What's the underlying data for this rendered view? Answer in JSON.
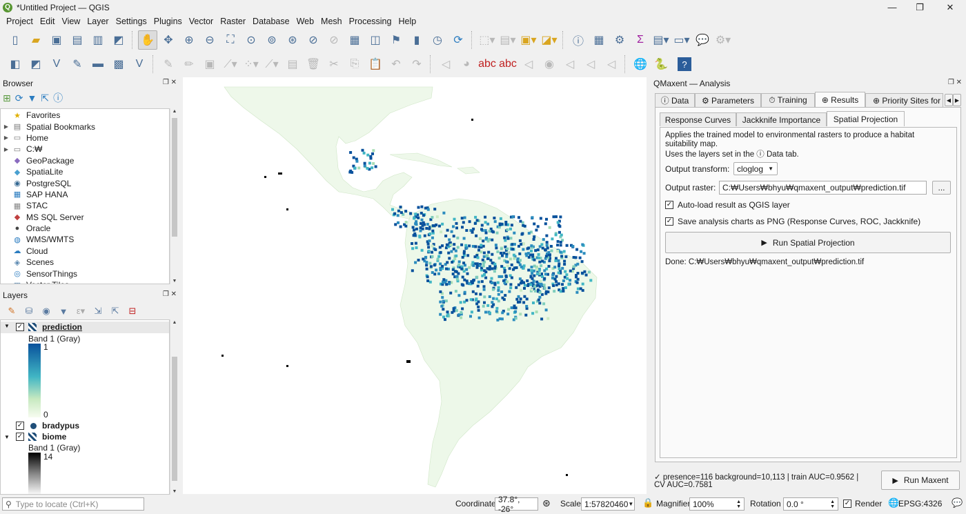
{
  "window": {
    "title": "*Untitled Project — QGIS",
    "minimize": "—",
    "maximize": "❐",
    "close": "✕"
  },
  "menu": [
    "Project",
    "Edit",
    "View",
    "Layer",
    "Settings",
    "Plugins",
    "Vector",
    "Raster",
    "Database",
    "Web",
    "Mesh",
    "Processing",
    "Help"
  ],
  "browser": {
    "title": "Browser",
    "items": [
      {
        "label": "Favorites",
        "icon": "star-icon"
      },
      {
        "label": "Spatial Bookmarks",
        "icon": "bookmark-icon"
      },
      {
        "label": "Home",
        "icon": "folder-icon"
      },
      {
        "label": "C:₩",
        "icon": "drive-icon"
      },
      {
        "label": "GeoPackage",
        "icon": "geopackage-icon"
      },
      {
        "label": "SpatiaLite",
        "icon": "spatialite-icon"
      },
      {
        "label": "PostgreSQL",
        "icon": "postgresql-icon"
      },
      {
        "label": "SAP HANA",
        "icon": "saphana-icon"
      },
      {
        "label": "STAC",
        "icon": "stac-icon"
      },
      {
        "label": "MS SQL Server",
        "icon": "mssql-icon"
      },
      {
        "label": "Oracle",
        "icon": "oracle-icon"
      },
      {
        "label": "WMS/WMTS",
        "icon": "wms-icon"
      },
      {
        "label": "Cloud",
        "icon": "cloud-icon"
      },
      {
        "label": "Scenes",
        "icon": "scenes-icon"
      },
      {
        "label": "SensorThings",
        "icon": "sensorthings-icon"
      },
      {
        "label": "Vector Tiles",
        "icon": "vectortiles-icon"
      }
    ]
  },
  "layers": {
    "title": "Layers",
    "prediction": {
      "name": "prediction",
      "band": "Band 1 (Gray)",
      "max": "1",
      "min": "0"
    },
    "bradypus": {
      "name": "bradypus"
    },
    "biome": {
      "name": "biome",
      "band": "Band 1 (Gray)",
      "max": "14"
    }
  },
  "dock": {
    "title": "QMaxent — Analysis",
    "tabs": [
      "ⓘ Data",
      "⚙ Parameters",
      "⏱ Training",
      "⊕ Results",
      "⊕ Priority Sites for S"
    ],
    "subtabs": [
      "Response Curves",
      "Jackknife Importance",
      "Spatial Projection"
    ],
    "desc1": "Applies the trained model to environmental rasters to produce a habitat suitability map.",
    "desc2": "Uses the layers set in the ⓘ Data tab.",
    "output_transform_label": "Output transform:",
    "output_transform_value": "cloglog",
    "output_raster_label": "Output raster:",
    "output_raster_value": "C:₩Users₩bhyu₩qmaxent_output₩prediction.tif",
    "browse": "...",
    "autoload": "Auto-load result as QGIS layer",
    "savepng": "Save analysis charts as PNG (Response Curves, ROC, Jackknife)",
    "run_projection": "Run Spatial Projection",
    "done": "Done: C:₩Users₩bhyu₩qmaxent_output₩prediction.tif",
    "summary1": "✓ presence=116  background=10,113  |  train AUC=0.9562  |",
    "summary2": "CV AUC=0.7581",
    "run_maxent": "Run Maxent"
  },
  "status": {
    "locate_placeholder": "Type to locate (Ctrl+K)",
    "coord_label": "Coordinate",
    "coord": "37.8°, -26°",
    "scale_label": "Scale",
    "scale": "1:57820460",
    "magnifier_label": "Magnifier",
    "magnifier": "100%",
    "rotation_label": "Rotation",
    "rotation": "0.0 °",
    "render": "Render",
    "crs": "EPSG:4326"
  },
  "colors": {
    "ramp_high": "#08519c",
    "ramp_mid": "#41b6c4",
    "ramp_low": "#f7fcf0",
    "accent": "#2f7fc1"
  }
}
